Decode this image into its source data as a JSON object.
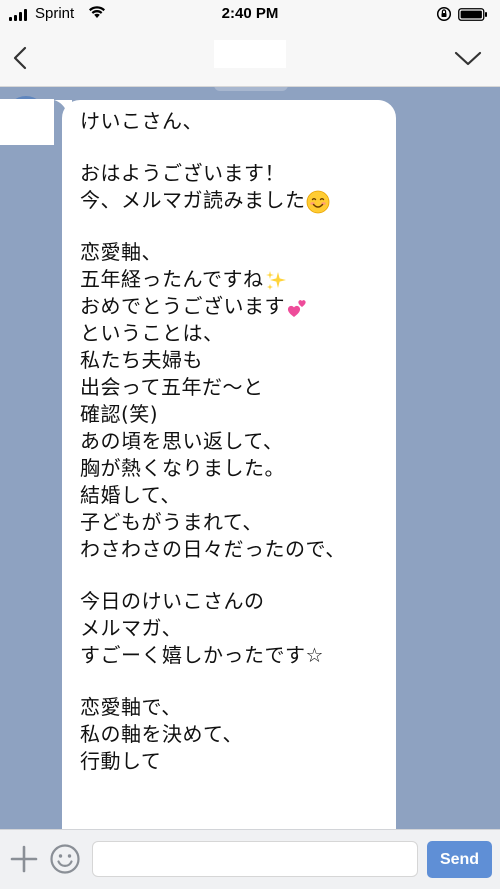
{
  "status_bar": {
    "carrier": "Sprint",
    "time": "2:40 PM"
  },
  "header": {
    "title": ""
  },
  "message": {
    "lines": [
      {
        "text": "けいこさん、"
      },
      {
        "gap": true
      },
      {
        "text": "おはようございます！"
      },
      {
        "text": "今、メルマガ読みました",
        "emoji": "smiling-face-emoji"
      },
      {
        "gap": true
      },
      {
        "text": "恋愛軸、"
      },
      {
        "text": "五年経ったんですね",
        "emoji": "sparkles-emoji"
      },
      {
        "text": "おめでとうございます",
        "emoji": "two-hearts-emoji"
      },
      {
        "text": "ということは、"
      },
      {
        "text": "私たち夫婦も"
      },
      {
        "text": "出会って五年だ〜と"
      },
      {
        "text": "確認(笑)"
      },
      {
        "text": "あの頃を思い返して、"
      },
      {
        "text": "胸が熱くなりました。"
      },
      {
        "text": "結婚して、"
      },
      {
        "text": "子どもがうまれて、"
      },
      {
        "text": "わさわさの日々だったので、"
      },
      {
        "gap": true
      },
      {
        "text": "今日のけいこさんの"
      },
      {
        "text": "メルマガ、"
      },
      {
        "text": "すごーく嬉しかったです☆"
      },
      {
        "gap": true
      },
      {
        "text": "恋愛軸で、"
      },
      {
        "text": "私の軸を決めて、"
      },
      {
        "text": "行動して"
      }
    ]
  },
  "input_bar": {
    "placeholder": "",
    "send_label": "Send"
  },
  "colors": {
    "chat_background": "#8ea2c1",
    "bubble": "#ffffff",
    "send_button": "#5f8fd6",
    "bars": "#f7f7f7"
  }
}
